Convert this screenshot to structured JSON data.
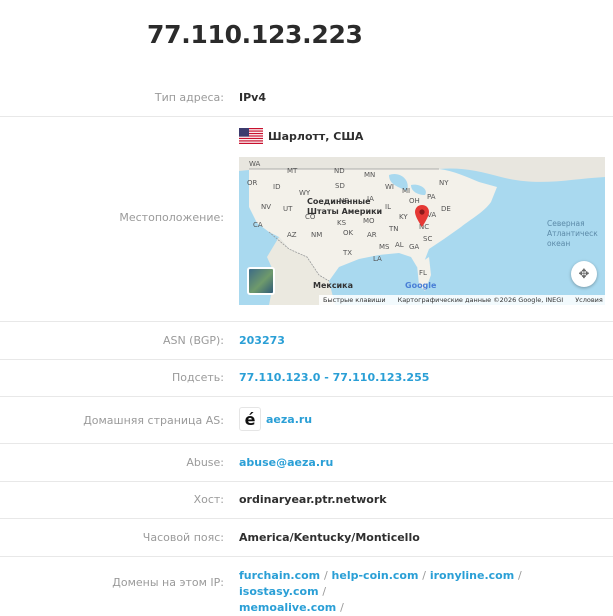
{
  "ip": "77.110.123.223",
  "rows": {
    "address_type": {
      "label": "Тип адреса:",
      "value": "IPv4"
    },
    "location": {
      "label": "Местоположение:",
      "value": "Шарлотт, США",
      "map": {
        "country_label": "Соединенные\nШтаты Америки",
        "mexico_label": "Мексика",
        "ocean_label": "Северная\nАтлантическ\nокеан",
        "state_labels": [
          "WA",
          "MT",
          "ND",
          "MN",
          "OR",
          "ID",
          "WY",
          "SD",
          "WI",
          "MI",
          "NY",
          "NV",
          "UT",
          "CO",
          "NE",
          "IA",
          "IL",
          "OH",
          "PA",
          "CA",
          "KS",
          "MO",
          "KY",
          "VA",
          "DE",
          "AZ",
          "NM",
          "OK",
          "AR",
          "TN",
          "NC",
          "SC",
          "TX",
          "MS",
          "AL",
          "GA",
          "LA",
          "FL"
        ],
        "footer_shortcuts": "Быстрые клавиши",
        "footer_data": "Картографические данные ©2026 Google, INEGI",
        "footer_terms": "Условия",
        "google": "Google",
        "marker_color": "#e53935"
      }
    },
    "asn": {
      "label": "ASN (BGP):",
      "value": "203273"
    },
    "subnet": {
      "label": "Подсеть:",
      "value": "77.110.123.0 - 77.110.123.255"
    },
    "homepage": {
      "label": "Домашняя страница AS:",
      "value": "aeza.ru",
      "logo_char": "é"
    },
    "abuse": {
      "label": "Abuse:",
      "value": "abuse@aeza.ru"
    },
    "host": {
      "label": "Хост:",
      "value": "ordinaryear.ptr.network"
    },
    "timezone": {
      "label": "Часовой пояс:",
      "value": "America/Kentucky/Monticello"
    },
    "domains": {
      "label": "Домены на этом IP:",
      "items": [
        "furchain.com",
        "help-coin.com",
        "ironyline.com",
        "isostasy.com",
        "memoalive.com"
      ],
      "separator": "/"
    }
  },
  "colors": {
    "link": "#2a9fd6",
    "label": "#9a9a9a",
    "divider": "#e8e8e8"
  }
}
